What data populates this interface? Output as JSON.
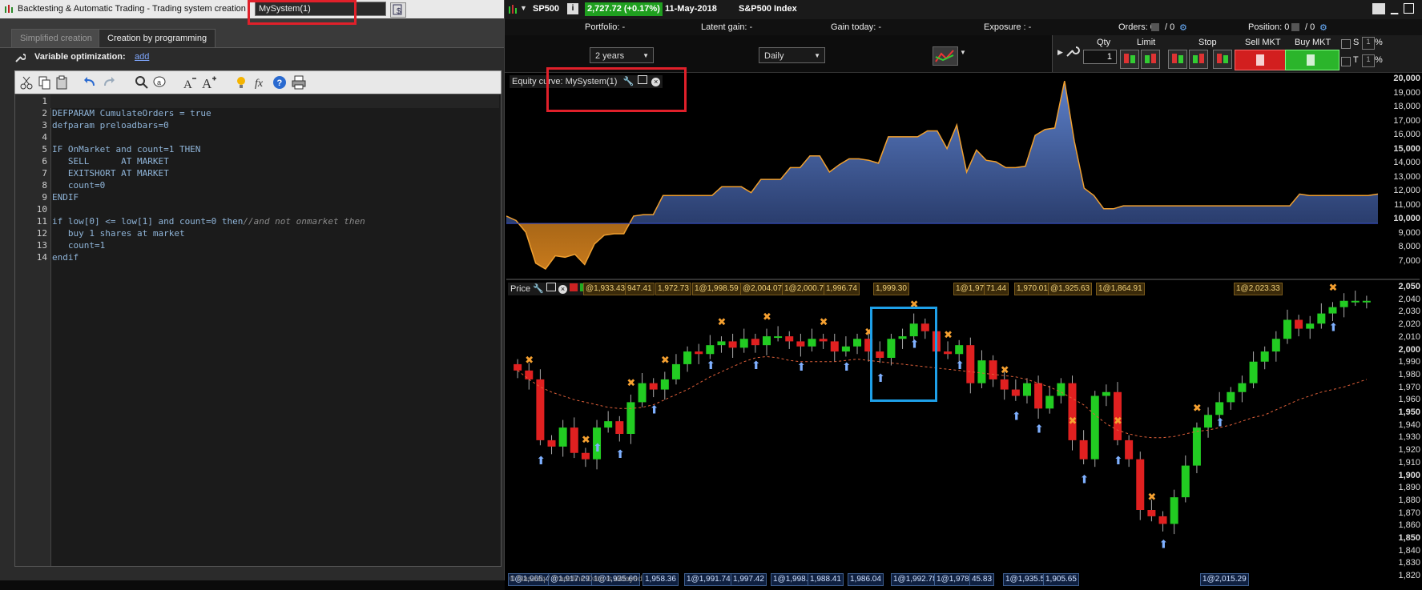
{
  "left": {
    "title": "Backtesting & Automatic Trading - Trading system creation",
    "system_name": "MySystem(1)",
    "tabs": [
      "Simplified creation",
      "Creation by programming"
    ],
    "var_opt_label": "Variable optimization:",
    "var_opt_link": "add",
    "toolbar_icons": [
      "cut-icon",
      "copy-icon",
      "paste-icon",
      "undo-icon",
      "redo-icon",
      "search-icon",
      "find-replace-icon",
      "decrease-font-icon",
      "increase-font-icon",
      "idea-icon",
      "function-icon",
      "help-icon",
      "print-icon"
    ],
    "code": [
      "",
      "DEFPARAM CumulateOrders = true",
      "defparam preloadbars=0",
      "",
      "IF OnMarket and count=1 THEN",
      "   SELL      AT MARKET",
      "   EXITSHORT AT MARKET",
      "   count=0",
      "ENDIF",
      "",
      "if low[0] <= low[1] and count=0 then//and not onmarket then",
      "   buy 1 shares at market",
      "   count=1",
      "endif"
    ]
  },
  "right": {
    "symbol": "SP500",
    "price_badge": "2,727.72 (+0.17%)",
    "date": "11-May-2018",
    "instrument": "S&P500 Index",
    "info": {
      "portfolio": "Portfolio: -",
      "latent_gain": "Latent gain: -",
      "gain_today": "Gain today: -",
      "exposure": "Exposure : -",
      "orders": "Orders: 0",
      "orders_slash": "/ 0",
      "position": "Position: 0",
      "position_slash": "/ 0"
    },
    "period": "2 years",
    "interval": "Daily",
    "order_labels": {
      "qty": "Qty",
      "limit": "Limit",
      "stop": "Stop",
      "sell_mkt": "Sell MKT",
      "buy_mkt": "Buy MKT"
    },
    "qty_value": "1",
    "s_label": "S",
    "t_label": "T",
    "pct": "%",
    "s_pct_val": "1",
    "t_pct_val": "1",
    "equity_label": "Equity curve: MySystem(1)",
    "price_label": "Price",
    "equity_axis": [
      "20,000",
      "19,000",
      "18,000",
      "17,000",
      "16,000",
      "15,000",
      "14,000",
      "13,000",
      "12,000",
      "11,000",
      "10,000",
      "9,000",
      "8,000",
      "7,000"
    ],
    "price_axis": [
      "2,050",
      "2,040",
      "2,030",
      "2,020",
      "2,010",
      "2,000",
      "1,990",
      "1,980",
      "1,970",
      "1,960",
      "1,950",
      "1,940",
      "1,930",
      "1,920",
      "1,910",
      "1,900",
      "1,890",
      "1,880",
      "1,870",
      "1,860",
      "1,850",
      "1,840",
      "1,830",
      "1,820"
    ],
    "top_tags": [
      "@1,933.43",
      "947.41",
      "1,972.73",
      "1@1,998.59",
      "@2,004.07",
      "1@2,000.73",
      "1,996.74",
      "1,999.30",
      "1@1,978.96",
      "71.44",
      "1,970.01",
      "@1,925.63",
      "1@1,864.91",
      "1@2,023.33"
    ],
    "bottom_tags": [
      "1@1,965.44",
      "@1,917.29",
      "1@1,935.60",
      "1,958.36",
      "1@1,991.74",
      "1,997.42",
      "1@1,998.00",
      "1,988.41",
      "1,986.04",
      "1@1,992.78",
      "1@1,978.21",
      "45.83",
      "1@1,935.55",
      "1,905.65",
      "1@2,015.29"
    ],
    "footer_text": "© Nasdaq / Tradeline Data is delayed"
  }
}
